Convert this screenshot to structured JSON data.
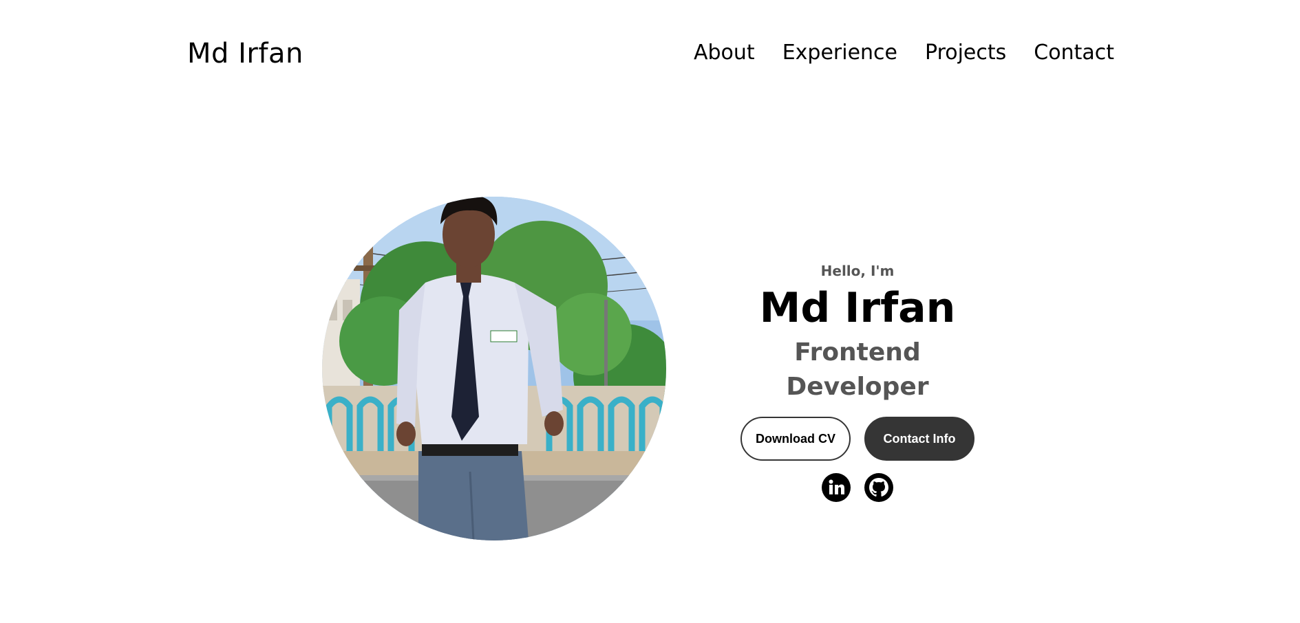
{
  "header": {
    "logo": "Md Irfan",
    "nav": [
      "About",
      "Experience",
      "Projects",
      "Contact"
    ]
  },
  "hero": {
    "greeting": "Hello, I'm",
    "name": "Md Irfan",
    "role": "Frontend Developer",
    "buttons": {
      "download_cv": "Download CV",
      "contact_info": "Contact Info"
    },
    "socials": [
      "linkedin-icon",
      "github-icon"
    ]
  },
  "colors": {
    "text": "#000000",
    "muted": "#555555",
    "button_dark": "#353535",
    "background": "#ffffff"
  }
}
